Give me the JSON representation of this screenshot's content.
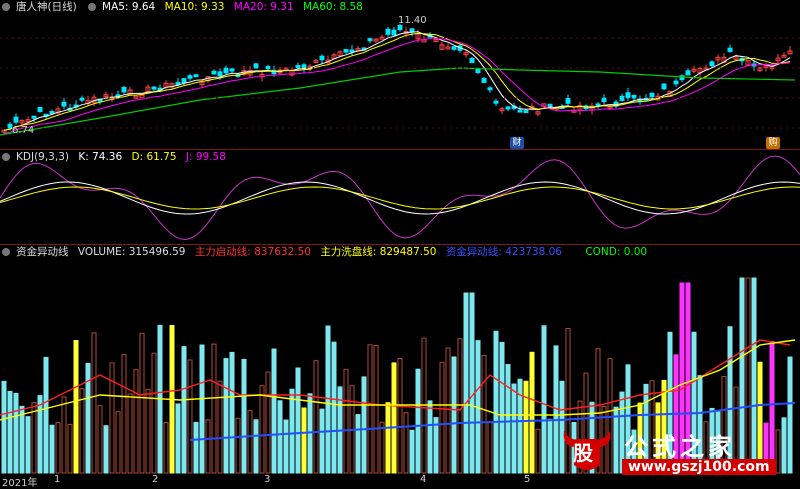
{
  "main": {
    "title": "唐人神(日线)",
    "ma5": "MA5: 9.64",
    "ma10": "MA10: 9.33",
    "ma20": "MA20: 9.31",
    "ma60": "MA60: 8.58",
    "high_label": "11.40",
    "low_label": "6.74",
    "badges": [
      "财",
      "购"
    ],
    "colors": {
      "ma5": "#ffffff",
      "ma10": "#ffff00",
      "ma20": "#ff00ff",
      "ma60": "#00ff00",
      "up": "#ff4444",
      "down": "#00ffff"
    }
  },
  "kdj": {
    "title": "KDJ(9,3,3)",
    "k": "K: 74.36",
    "d": "D: 61.75",
    "j": "J: 99.58"
  },
  "volume": {
    "title": "资金异动线",
    "volume": "VOLUME: 315496.59",
    "start": "主力启动线: 837632.50",
    "wash": "主力洗盘线: 829487.50",
    "fund": "资金异动线: 423738.06",
    "cond": "COND: 0.00"
  },
  "xaxis": {
    "labels": [
      "2021年",
      "1",
      "2",
      "3",
      "4",
      "5"
    ]
  },
  "watermark": {
    "logo_char": "股",
    "name": "公式之家",
    "url": "www.gszj100.com"
  }
}
